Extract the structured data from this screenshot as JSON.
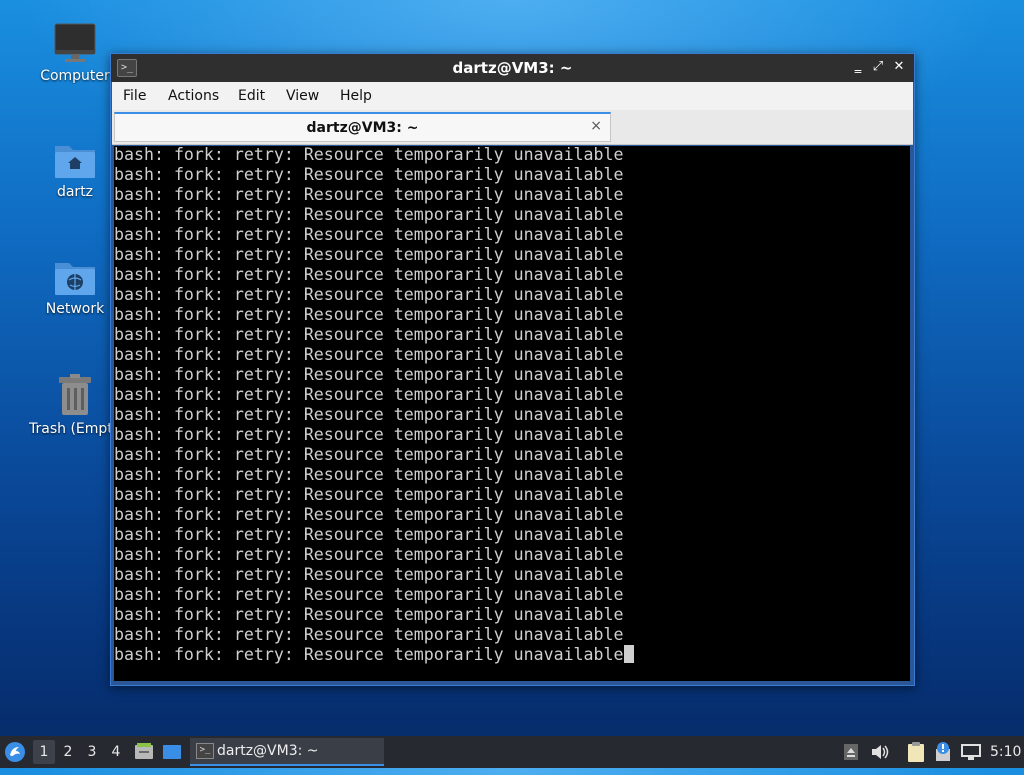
{
  "desktop": {
    "icons": [
      {
        "label": "Computer",
        "icon": "monitor-icon"
      },
      {
        "label": "dartz",
        "icon": "home-folder-icon"
      },
      {
        "label": "Network",
        "icon": "network-folder-icon"
      },
      {
        "label": "Trash (Empty)",
        "icon": "trash-icon"
      }
    ]
  },
  "window": {
    "title": "dartz@VM3: ~",
    "app_icon": ">_",
    "controls": {
      "minimize": "‗",
      "maximize": "⤢",
      "close": "✕"
    },
    "menu": [
      "File",
      "Actions",
      "Edit",
      "View",
      "Help"
    ],
    "tab": {
      "label": "dartz@VM3: ~",
      "close": "×"
    },
    "terminal": {
      "lines": [
        "bash: fork: retry: Resource temporarily unavailable",
        "bash: fork: retry: Resource temporarily unavailable",
        "bash: fork: retry: Resource temporarily unavailable",
        "bash: fork: retry: Resource temporarily unavailable",
        "bash: fork: retry: Resource temporarily unavailable",
        "bash: fork: retry: Resource temporarily unavailable",
        "bash: fork: retry: Resource temporarily unavailable",
        "bash: fork: retry: Resource temporarily unavailable",
        "bash: fork: retry: Resource temporarily unavailable",
        "bash: fork: retry: Resource temporarily unavailable",
        "bash: fork: retry: Resource temporarily unavailable",
        "bash: fork: retry: Resource temporarily unavailable",
        "bash: fork: retry: Resource temporarily unavailable",
        "bash: fork: retry: Resource temporarily unavailable",
        "bash: fork: retry: Resource temporarily unavailable",
        "bash: fork: retry: Resource temporarily unavailable",
        "bash: fork: retry: Resource temporarily unavailable",
        "bash: fork: retry: Resource temporarily unavailable",
        "bash: fork: retry: Resource temporarily unavailable",
        "bash: fork: retry: Resource temporarily unavailable",
        "bash: fork: retry: Resource temporarily unavailable",
        "bash: fork: retry: Resource temporarily unavailable",
        "bash: fork: retry: Resource temporarily unavailable",
        "bash: fork: retry: Resource temporarily unavailable",
        "bash: fork: retry: Resource temporarily unavailable",
        "bash: fork: retry: Resource temporarily unavailable"
      ]
    }
  },
  "taskbar": {
    "start_icon": "start-menu-icon",
    "workspaces": [
      "1",
      "2",
      "3",
      "4"
    ],
    "active_workspace": "1",
    "launchers": [
      "file-manager-icon",
      "show-desktop-icon"
    ],
    "task": {
      "label": "dartz@VM3: ~",
      "icon": ">_"
    },
    "tray": [
      "eject-icon",
      "volume-icon",
      "clipboard-icon",
      "update-notifier-icon",
      "network-icon"
    ],
    "clock": "5:10"
  },
  "colors": {
    "accent": "#3a8ee6",
    "terminal_bg": "#000000",
    "terminal_fg": "#cfcfcf",
    "taskbar_bg": "#262a30"
  }
}
